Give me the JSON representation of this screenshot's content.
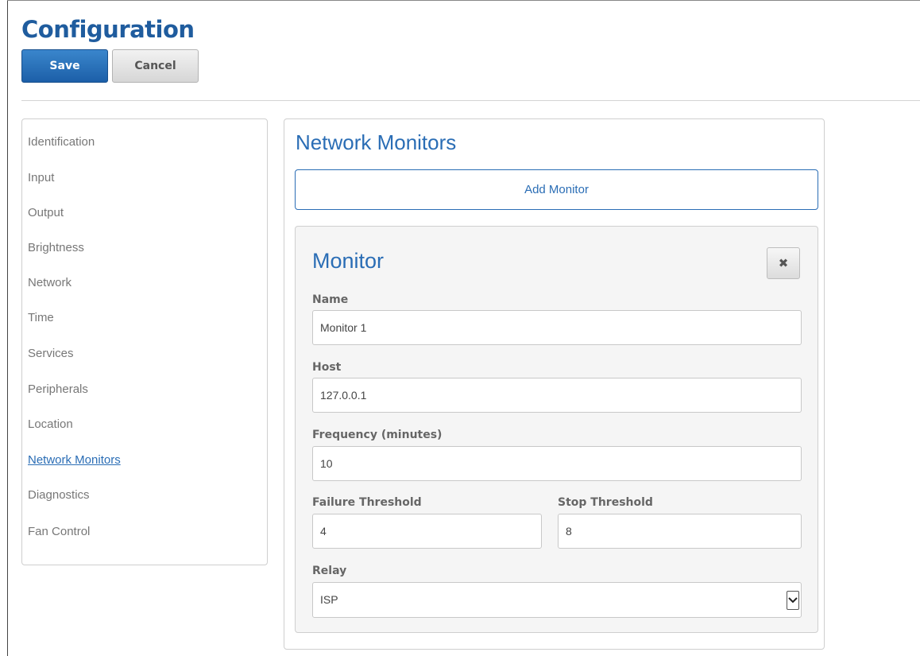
{
  "header": {
    "title": "Configuration",
    "save_label": "Save",
    "cancel_label": "Cancel"
  },
  "sidebar": {
    "items": [
      {
        "label": "Identification"
      },
      {
        "label": "Input"
      },
      {
        "label": "Output"
      },
      {
        "label": "Brightness"
      },
      {
        "label": "Network"
      },
      {
        "label": "Time"
      },
      {
        "label": "Services"
      },
      {
        "label": "Peripherals"
      },
      {
        "label": "Location"
      },
      {
        "label": "Network Monitors",
        "active": true
      },
      {
        "label": "Diagnostics"
      },
      {
        "label": "Fan Control"
      }
    ]
  },
  "main": {
    "title": "Network Monitors",
    "add_label": "Add Monitor",
    "monitor": {
      "title": "Monitor",
      "close_icon": "close-icon",
      "name_label": "Name",
      "name_value": "Monitor 1",
      "host_label": "Host",
      "host_value": "127.0.0.1",
      "frequency_label": "Frequency (minutes)",
      "frequency_value": "10",
      "failure_label": "Failure Threshold",
      "failure_value": "4",
      "stop_label": "Stop Threshold",
      "stop_value": "8",
      "relay_label": "Relay",
      "relay_value": "ISP"
    }
  },
  "colors": {
    "accent": "#2a6db5",
    "title": "#1f5c9e",
    "save_button": "#1c5fa8"
  }
}
